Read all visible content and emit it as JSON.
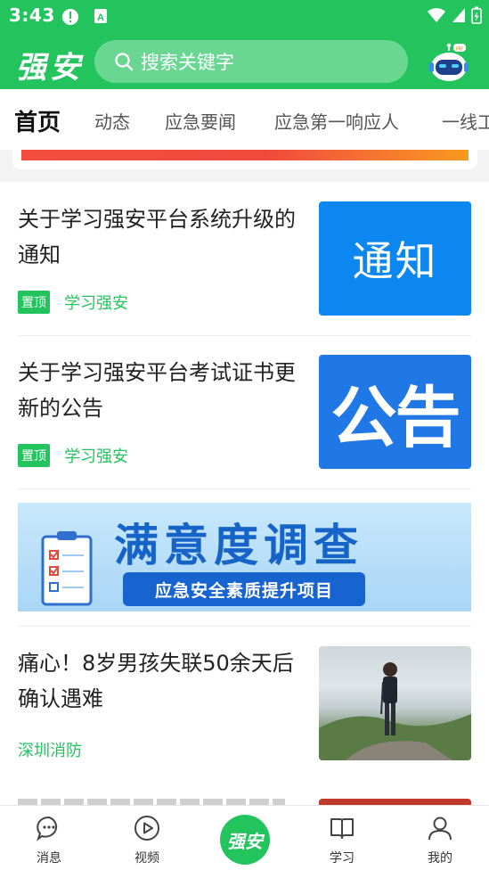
{
  "status_bar": {
    "time": "3:43"
  },
  "header": {
    "logo": "强安",
    "search_placeholder": "搜索关键字"
  },
  "tabs": [
    {
      "label": "首页",
      "active": true
    },
    {
      "label": "动态",
      "active": false
    },
    {
      "label": "应急要闻",
      "active": false
    },
    {
      "label": "应急第一响应人",
      "active": false
    },
    {
      "label": "一线工",
      "active": false
    }
  ],
  "feed": {
    "items": [
      {
        "title": "关于学习强安平台系统升级的通知",
        "badge": "置顶",
        "source": "学习强安",
        "thumb_text": "通知"
      },
      {
        "title": "关于学习强安平台考试证书更新的公告",
        "badge": "置顶",
        "source": "学习强安",
        "thumb_text": "公告"
      },
      {
        "title": "痛心！8岁男孩失联50余天后确认遇难",
        "badge": "",
        "source": "深圳消防",
        "thumb_text": ""
      }
    ],
    "survey_banner": {
      "title": "满意度调查",
      "subtitle": "应急安全素质提升项目"
    }
  },
  "bottom_nav": {
    "items": [
      {
        "label": "消息",
        "icon": "chat-bubble-icon"
      },
      {
        "label": "视频",
        "icon": "play-circle-icon"
      },
      {
        "label": "学习",
        "icon": "book-icon"
      },
      {
        "label": "我的",
        "icon": "user-icon"
      }
    ],
    "center_label": "强安"
  },
  "colors": {
    "brand_green": "#23c45e",
    "notice_blue": "#0c87ef",
    "announcement_blue": "#1f78e6"
  }
}
